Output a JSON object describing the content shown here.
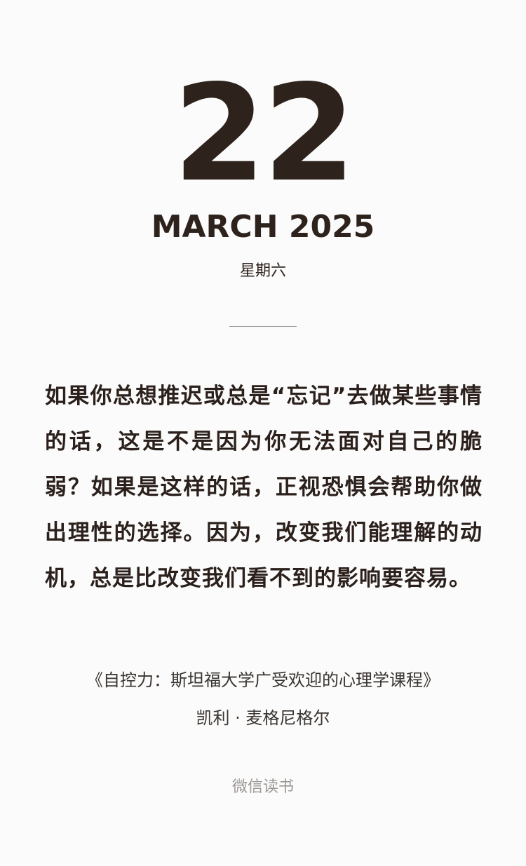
{
  "date": {
    "day": "22",
    "month_year": "MARCH 2025",
    "weekday": "星期六"
  },
  "quote": {
    "text": "如果你总想推迟或总是“忘记”去做某些事情的话，这是不是因为你无法面对自己的脆弱？如果是这样的话，正视恐惧会帮助你做出理性的选择。因为，改变我们能理解的动机，总是比改变我们看不到的影响要容易。"
  },
  "attribution": {
    "book": "《自控力：斯坦福大学广受欢迎的心理学课程》",
    "author": "凯利 · 麦格尼格尔"
  },
  "footer": {
    "source": "微信读书"
  },
  "colors": {
    "background": "#fbfbfb",
    "primary_text": "#2e221c",
    "muted_text": "#9c9794"
  }
}
